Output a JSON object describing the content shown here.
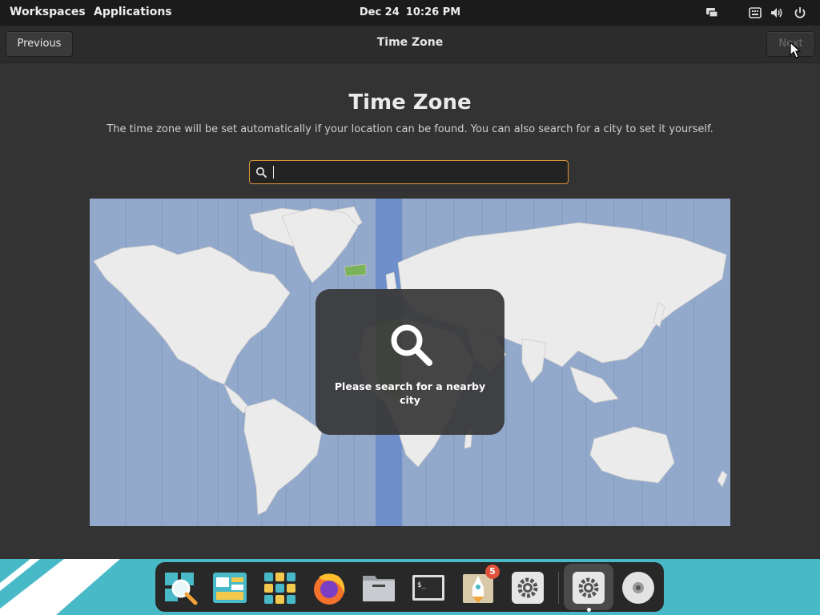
{
  "topbar": {
    "workspaces_label": "Workspaces",
    "applications_label": "Applications",
    "date": "Dec 24",
    "time": "10:26 PM",
    "tray_icons": [
      "display-icon",
      "keyboard-icon",
      "volume-icon",
      "power-icon"
    ]
  },
  "header": {
    "previous_label": "Previous",
    "title": "Time Zone",
    "next_label": "Next"
  },
  "main": {
    "heading": "Time Zone",
    "description": "The time zone will be set automatically if your location can be found. You can also search for a city to set it yourself.",
    "search": {
      "value": "",
      "placeholder": ""
    },
    "map_overlay_text": "Please search for a nearby city"
  },
  "dock": {
    "items": [
      {
        "icon": "search-app-icon"
      },
      {
        "icon": "files-layout-icon"
      },
      {
        "icon": "app-grid-icon"
      },
      {
        "icon": "firefox-icon"
      },
      {
        "icon": "file-manager-icon"
      },
      {
        "icon": "terminal-icon"
      },
      {
        "icon": "launch-notes-icon",
        "badge": "5"
      },
      {
        "icon": "settings-icon"
      },
      {
        "icon": "settings-active-icon"
      },
      {
        "icon": "disc-icon"
      }
    ]
  },
  "colors": {
    "accent": "#e0983c",
    "dock_background": "#48b9c7",
    "map_ocean": "#93a9cb",
    "map_selected_zone": "#6e8fca"
  }
}
